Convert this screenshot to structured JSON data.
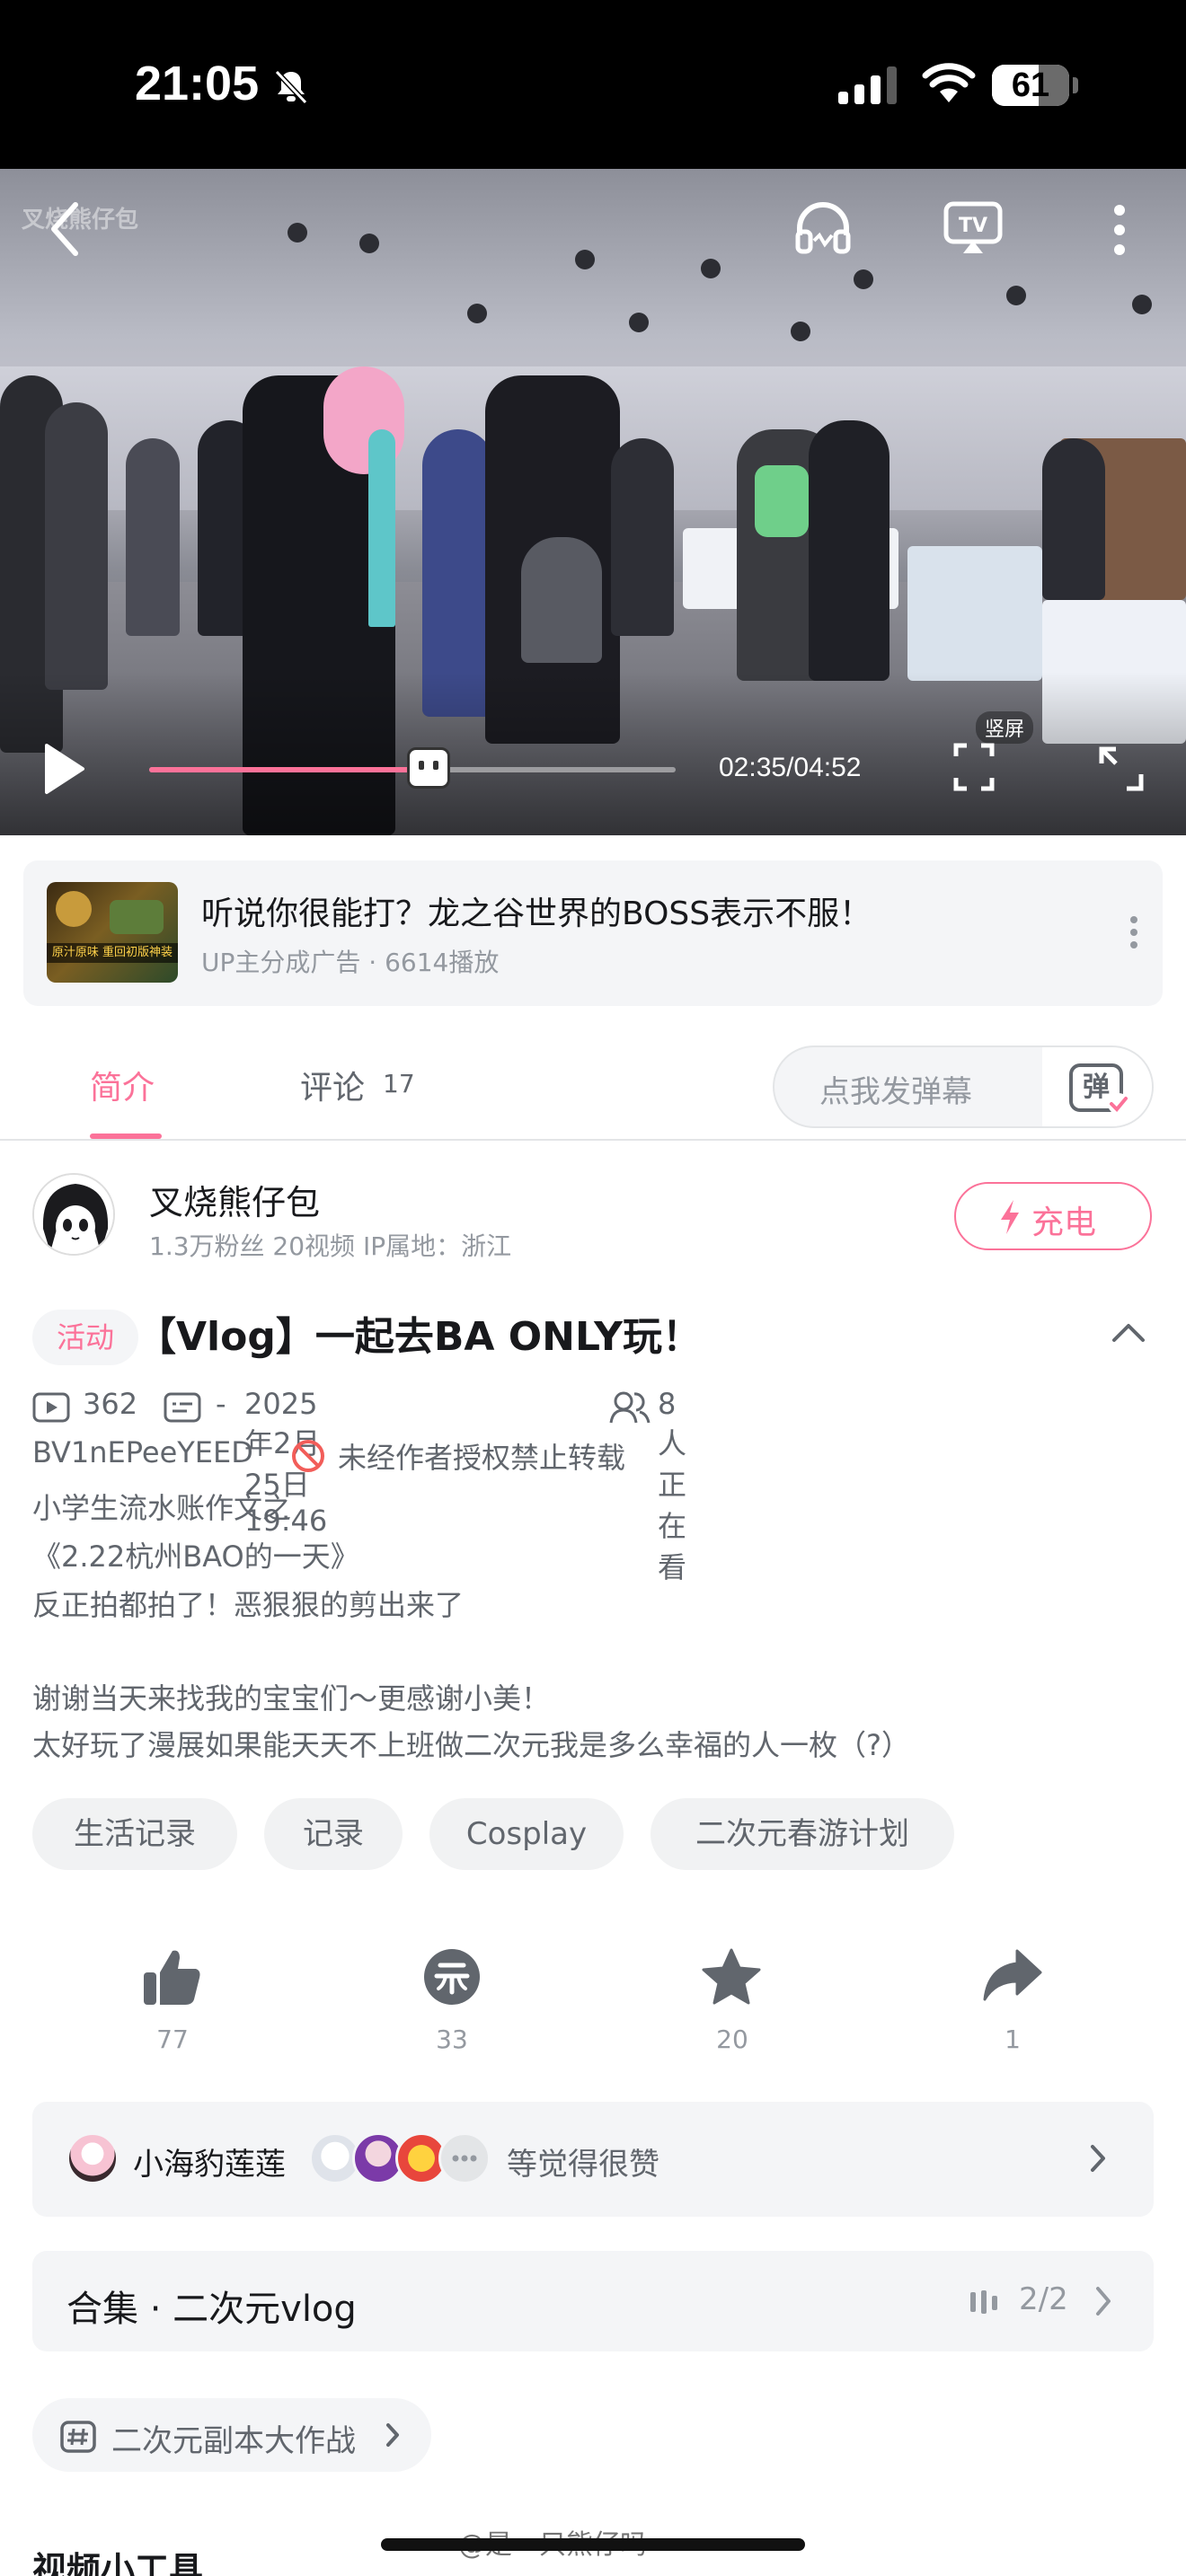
{
  "status_bar": {
    "time": "21:05",
    "battery": "61"
  },
  "player": {
    "watermark": "叉烧熊仔包",
    "time": "02:35/04:52",
    "progress": 0.53,
    "vertical_label": "竖屏"
  },
  "ad": {
    "title": "听说你很能打？龙之谷世界的BOSS表示不服！",
    "subtitle": "UP主分成广告 · 6614播放",
    "thumb_text": "原汁原味 重回初版神装"
  },
  "tabs": {
    "intro": "简介",
    "comments": "评论",
    "comments_count": "17",
    "danmaku_placeholder": "点我发弹幕",
    "danmaku_glyph": "弹"
  },
  "uploader": {
    "name": "叉烧熊仔包",
    "meta": "1.3万粉丝   20视频   IP属地：浙江",
    "charge_label": "充电"
  },
  "video": {
    "badge": "活动",
    "title": "【Vlog】一起去BA ONLY玩！",
    "views": "362",
    "danmaku_count": "-",
    "date": "2025年2月25日 19:46",
    "watching": "8人正在看",
    "bvid": "BV1nEPeeYEED",
    "no_repost": "未经作者授权禁止转载",
    "description": [
      "小学生流水账作文之",
      "《2.22杭州BAO的一天》",
      "反正拍都拍了！恶狠狠的剪出来了",
      "",
      "谢谢当天来找我的宝宝们～更感谢小美！",
      "太好玩了漫展如果能天天不上班做二次元我是多么幸福的人一枚（?）"
    ]
  },
  "tags": [
    "生活记录",
    "记录",
    "Cosplay",
    "二次元春游计划"
  ],
  "actions": {
    "like": "77",
    "coin": "33",
    "favorite": "20",
    "share": "1"
  },
  "liked_by": {
    "name": "小海豹莲莲",
    "text": "等觉得很赞"
  },
  "collection": {
    "title": "合集 · 二次元vlog",
    "count": "2/2"
  },
  "topic": {
    "label": "二次元副本大作战"
  },
  "tools": {
    "title": "视频小工具"
  },
  "watermark": "@是一只熊仔吗",
  "colors": {
    "accent": "#fb7299",
    "text": "#18191c",
    "muted": "#9499a0"
  }
}
